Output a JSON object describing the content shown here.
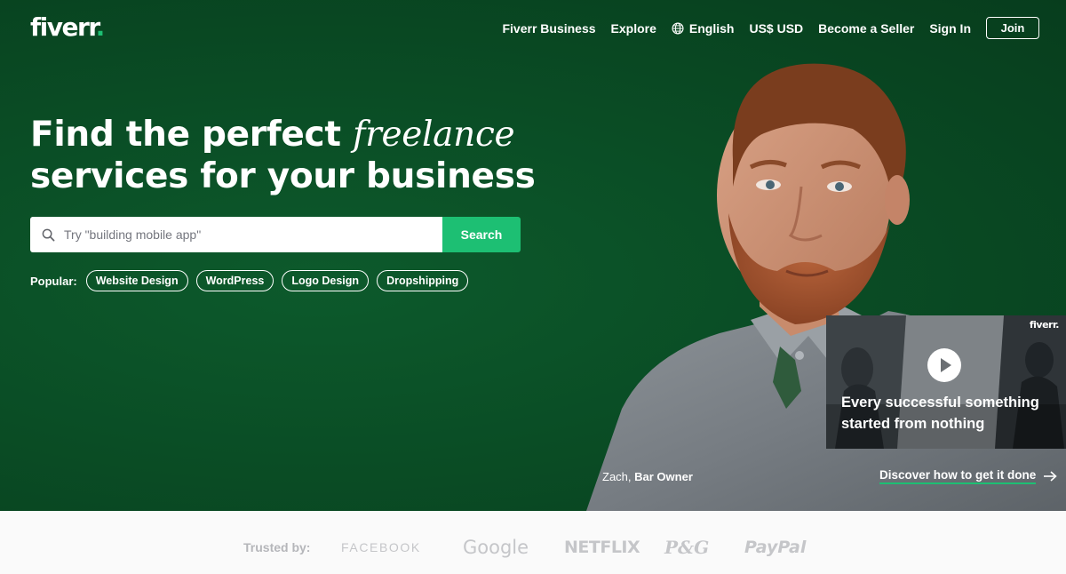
{
  "brand": {
    "name": "fiverr",
    "dot": "."
  },
  "nav": {
    "items": [
      "Fiverr Business",
      "Explore",
      "English",
      "US$ USD",
      "Become a Seller",
      "Sign In"
    ],
    "join": "Join"
  },
  "hero": {
    "headline_part1": "Find the perfect",
    "headline_emphasis": "freelance",
    "headline_line2": "services for your business",
    "search_placeholder": "Try \"building mobile app\"",
    "search_button": "Search",
    "popular_label": "Popular:",
    "popular": [
      "Website Design",
      "WordPress",
      "Logo Design",
      "Dropshipping"
    ],
    "caption_name": "Zach,",
    "caption_role": "Bar Owner"
  },
  "video": {
    "brand": "fiverr.",
    "line1": "Every successful something",
    "line2": "started from nothing",
    "link": "Discover how to get it done"
  },
  "trusted": {
    "label": "Trusted by:",
    "logos": [
      "FACEBOOK",
      "Google",
      "NETFLIX",
      "P&G",
      "PayPal"
    ]
  },
  "colors": {
    "hero_background": "#0a4d25",
    "accent": "#1dbf73",
    "trusted_background": "#fafafa",
    "logo_gray": "#c5c6c9"
  }
}
